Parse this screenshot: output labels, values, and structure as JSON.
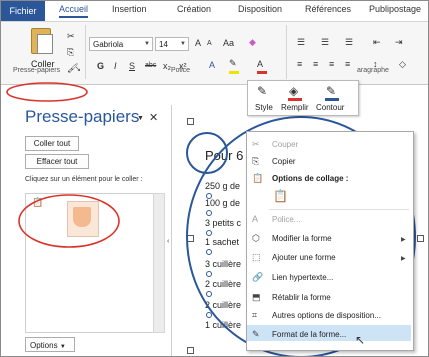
{
  "ribbon": {
    "tabs": [
      "Fichier",
      "Accueil",
      "Insertion",
      "Création",
      "Disposition",
      "Références",
      "Publipostage"
    ],
    "clipboard": {
      "paste_label": "Coller"
    },
    "font": {
      "name": "Gabriola",
      "size": "14",
      "change_case": "Aa",
      "increase": "A",
      "decrease": "A"
    },
    "format_buttons": [
      "G",
      "I",
      "S",
      "abc",
      "x₂",
      "x²"
    ],
    "groups": {
      "clipboard": "Presse-papiers",
      "font": "Police",
      "paragraph": "aragraphe"
    }
  },
  "mini_toolbar": {
    "items": [
      "Style",
      "Remplir",
      "Contour"
    ]
  },
  "clipboard_pane": {
    "title": "Presse-papiers",
    "paste_all": "Coller tout",
    "clear_all": "Effacer tout",
    "hint": "Cliquez sur un élément pour le coller :",
    "options": "Options"
  },
  "document": {
    "title": "Pour 6",
    "lines": [
      "250 g de",
      "100 g de",
      "3 petits c",
      "1 sachet",
      "3 cuillère",
      "2 cuillère",
      "2 cuillère",
      "1 cuillère"
    ]
  },
  "context_menu": {
    "items": [
      {
        "label": "Couper",
        "icon": "scissors-icon",
        "disabled": true
      },
      {
        "label": "Copier",
        "icon": "copy-icon"
      },
      {
        "label": "Options de collage :",
        "icon": "paste-icon",
        "bold": true
      },
      {
        "label": "Police...",
        "icon": "font-icon",
        "disabled": true
      },
      {
        "label": "Modifier la forme",
        "icon": "edit-shape-icon",
        "submenu": true
      },
      {
        "label": "Ajouter une forme",
        "icon": "add-shape-icon",
        "submenu": true
      },
      {
        "label": "Lien hypertexte...",
        "icon": "link-icon"
      },
      {
        "label": "Rétablir la forme",
        "icon": "reset-shape-icon"
      },
      {
        "label": "Autres options de disposition...",
        "icon": "layout-icon"
      },
      {
        "label": "Format de la forme...",
        "icon": "format-shape-icon",
        "highlighted": true
      }
    ]
  },
  "colors": {
    "accent": "#2b579a",
    "annotation": "#d9342b",
    "highlight": "#cde4f7"
  }
}
